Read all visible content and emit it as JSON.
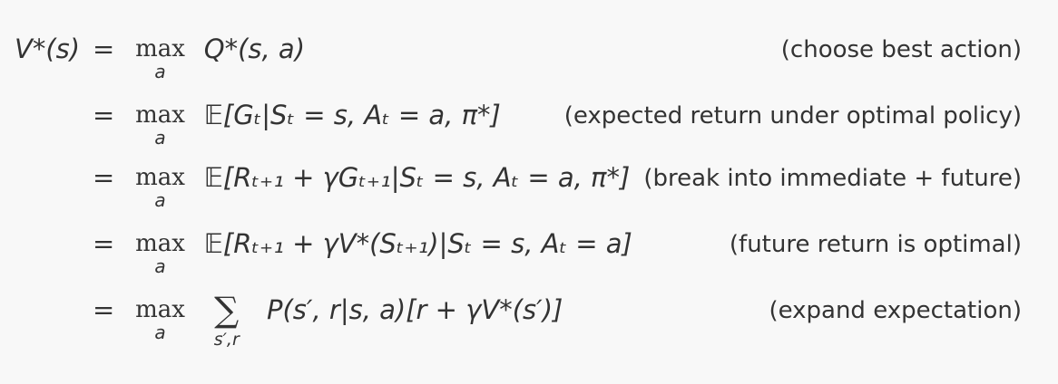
{
  "equation": {
    "lhs": "V*(s)",
    "lines": [
      {
        "operator": "max",
        "operator_sub": "a",
        "expression": "Q*(s, a)",
        "annotation": "(choose best action)"
      },
      {
        "operator": "max",
        "operator_sub": "a",
        "expression": "𝔼[Gₜ|Sₜ = s, Aₜ = a, π*]",
        "annotation": "(expected return under optimal policy)"
      },
      {
        "operator": "max",
        "operator_sub": "a",
        "expression": "𝔼[Rₜ₊₁ + γGₜ₊₁|Sₜ = s, Aₜ = a, π*]",
        "annotation": "(break into immediate + future)"
      },
      {
        "operator": "max",
        "operator_sub": "a",
        "expression": "𝔼[Rₜ₊₁ + γV*(Sₜ₊₁)|Sₜ = s, Aₜ = a]",
        "annotation": "(future return is optimal)"
      },
      {
        "operator": "max",
        "operator_sub": "a",
        "sum_symbol": "∑",
        "sum_sub": "s′,r",
        "expression": "P(s′, r|s, a)[r + γV*(s′)]",
        "annotation": "(expand expectation)"
      }
    ],
    "equals_sign": "="
  }
}
